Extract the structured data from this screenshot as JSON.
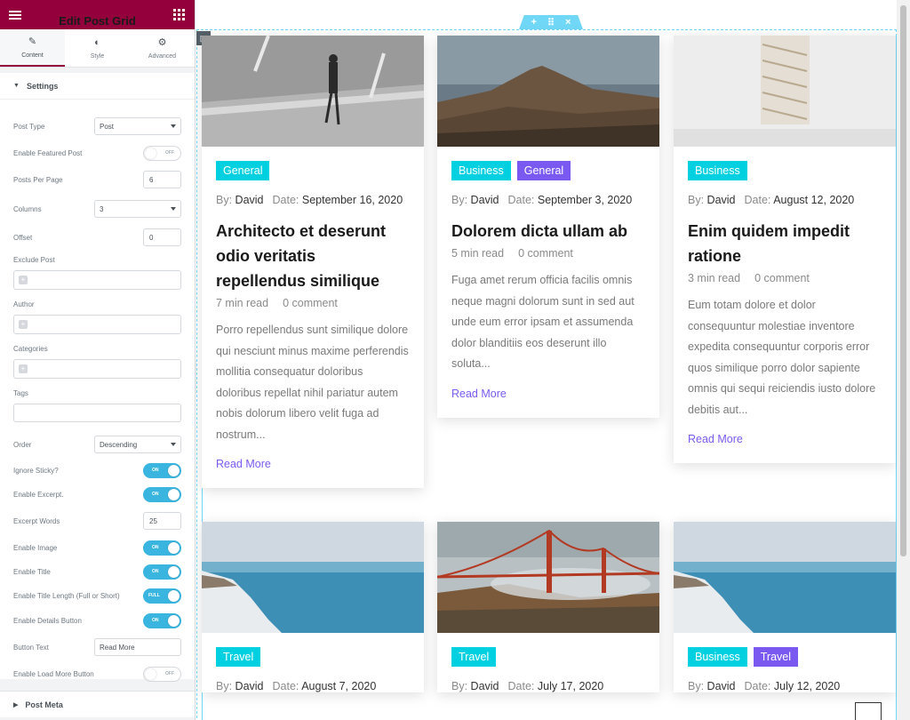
{
  "panel": {
    "title": "Edit Post Grid",
    "tabs": [
      {
        "label": "Content",
        "icon": "pencil-icon"
      },
      {
        "label": "Style",
        "icon": "half-circle-icon"
      },
      {
        "label": "Advanced",
        "icon": "gear-icon"
      }
    ],
    "section_title": "Settings",
    "post_type": {
      "label": "Post Type",
      "value": "Post"
    },
    "enable_featured": {
      "label": "Enable Featured Post",
      "state": "OFF"
    },
    "posts_per_page": {
      "label": "Posts Per Page",
      "value": "6"
    },
    "columns": {
      "label": "Columns",
      "value": "3"
    },
    "offset": {
      "label": "Offset",
      "value": "0"
    },
    "exclude_post": {
      "label": "Exclude Post"
    },
    "author": {
      "label": "Author"
    },
    "categories": {
      "label": "Categories"
    },
    "tags": {
      "label": "Tags"
    },
    "order": {
      "label": "Order",
      "value": "Descending"
    },
    "ignore_sticky": {
      "label": "Ignore Sticky?",
      "state": "ON"
    },
    "enable_excerpt": {
      "label": "Enable Excerpt.",
      "state": "ON"
    },
    "excerpt_words": {
      "label": "Excerpt Words",
      "value": "25"
    },
    "enable_image": {
      "label": "Enable Image",
      "state": "ON"
    },
    "enable_title": {
      "label": "Enable Title",
      "state": "ON"
    },
    "enable_title_length": {
      "label": "Enable Title Length (Full or Short)",
      "state": "FULL"
    },
    "enable_details_button": {
      "label": "Enable Details Button",
      "state": "ON"
    },
    "button_text": {
      "label": "Button Text",
      "value": "Read More"
    },
    "enable_load_more": {
      "label": "Enable Load More Button",
      "state": "OFF"
    },
    "post_meta": "Post Meta"
  },
  "labels": {
    "by": "By:",
    "date": "Date:"
  },
  "posts": [
    {
      "tags": [
        "General"
      ],
      "author": "David",
      "date": "September 16, 2020",
      "title": "Architecto et deserunt odio veritatis repellendus similique",
      "read_time": "7 min read",
      "comments": "0 comment",
      "excerpt": "Porro repellendus sunt similique dolore qui nesciunt minus maxime perferendis mollitia consequatur doloribus doloribus repellat nihil pariatur autem nobis dolorum libero velit fuga ad nostrum...",
      "read_more": "Read More"
    },
    {
      "tags": [
        "Business",
        "General"
      ],
      "author": "David",
      "date": "September 3, 2020",
      "title": "Dolorem dicta ullam ab",
      "read_time": "5 min read",
      "comments": "0 comment",
      "excerpt": "Fuga amet rerum officia facilis omnis neque magni dolorum sunt in sed aut unde eum error ipsam et assumenda dolor blanditiis eos deserunt illo soluta...",
      "read_more": "Read More"
    },
    {
      "tags": [
        "Business"
      ],
      "author": "David",
      "date": "August 12, 2020",
      "title": "Enim quidem impedit ratione",
      "read_time": "3 min read",
      "comments": "0 comment",
      "excerpt": "Eum totam dolore et dolor consequuntur molestiae inventore expedita consequuntur corporis error quos similique porro dolor sapiente omnis qui sequi reiciendis iusto dolore debitis aut...",
      "read_more": "Read More"
    },
    {
      "tags": [
        "Travel"
      ],
      "author": "David",
      "date": "August 7, 2020"
    },
    {
      "tags": [
        "Travel"
      ],
      "author": "David",
      "date": "July 17, 2020"
    },
    {
      "tags": [
        "Business",
        "Travel"
      ],
      "author": "David",
      "date": "July 12, 2020"
    }
  ],
  "colors": {
    "brand": "#93003c",
    "accent": "#71d7f7",
    "tag_cyan": "#00d0e0",
    "tag_purple": "#7a59f0",
    "toggle_on": "#39b5e0"
  }
}
